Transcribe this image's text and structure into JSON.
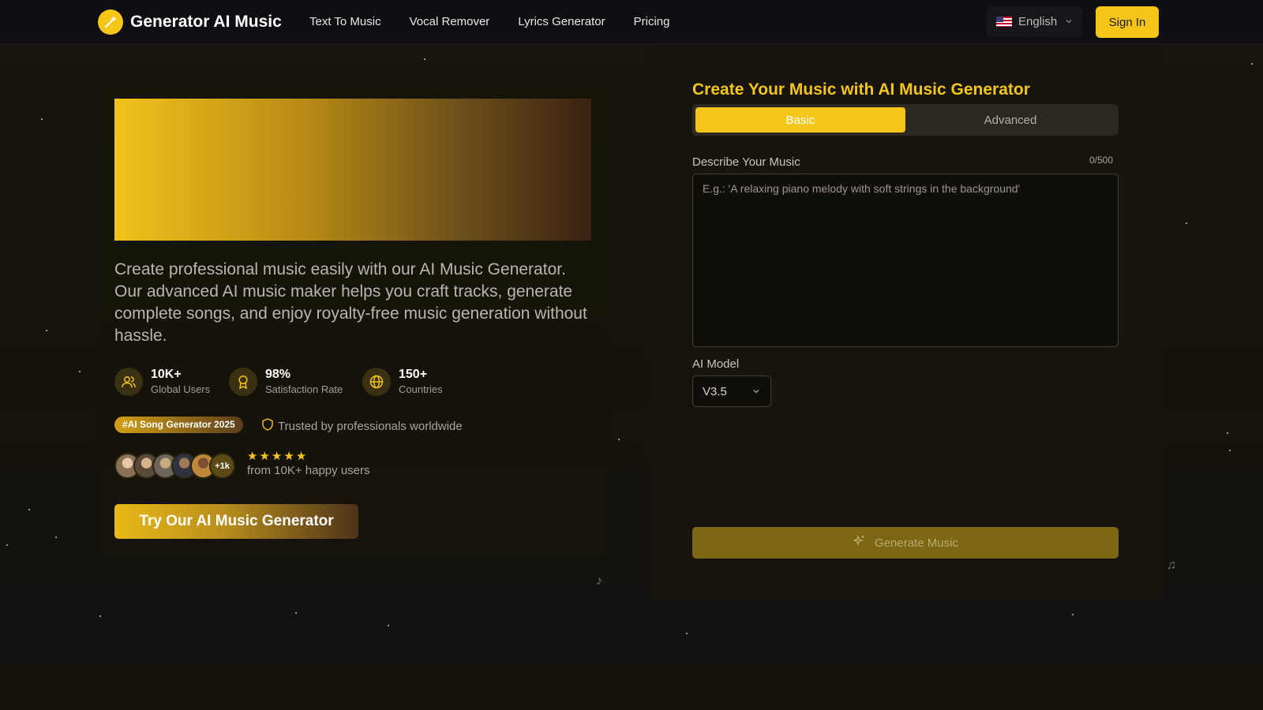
{
  "header": {
    "brand": "Generator AI Music",
    "nav": [
      "Text To Music",
      "Vocal Remover",
      "Lyrics Generator",
      "Pricing"
    ],
    "language": "English",
    "sign_in": "Sign In"
  },
  "hero": {
    "description": "Create professional music easily with our AI Music Generator. Our advanced AI music maker helps you craft tracks, generate complete songs, and enjoy royalty-free music generation without hassle.",
    "stats": [
      {
        "value": "10K+",
        "label": "Global Users",
        "icon": "users-icon"
      },
      {
        "value": "98%",
        "label": "Satisfaction Rate",
        "icon": "award-icon"
      },
      {
        "value": "150+",
        "label": "Countries",
        "icon": "globe-icon"
      }
    ],
    "badge": "#AI Song Generator 2025",
    "trusted": "Trusted by professionals worldwide",
    "avatar_more": "+1k",
    "rating": 5,
    "happy_users": "from 10K+ happy users",
    "cta": "Try Our AI Music Generator"
  },
  "generator": {
    "title": "Create Your Music with AI Music Generator",
    "tabs": [
      "Basic",
      "Advanced"
    ],
    "active_tab": "Basic",
    "describe_label": "Describe Your Music",
    "counter": "0/500",
    "placeholder": "E.g.: 'A relaxing piano melody with soft strings in the background'",
    "model_label": "AI Model",
    "model_value": "V3.5",
    "generate": "Generate Music"
  },
  "colors": {
    "accent": "#f5c518",
    "background": "#151309"
  }
}
